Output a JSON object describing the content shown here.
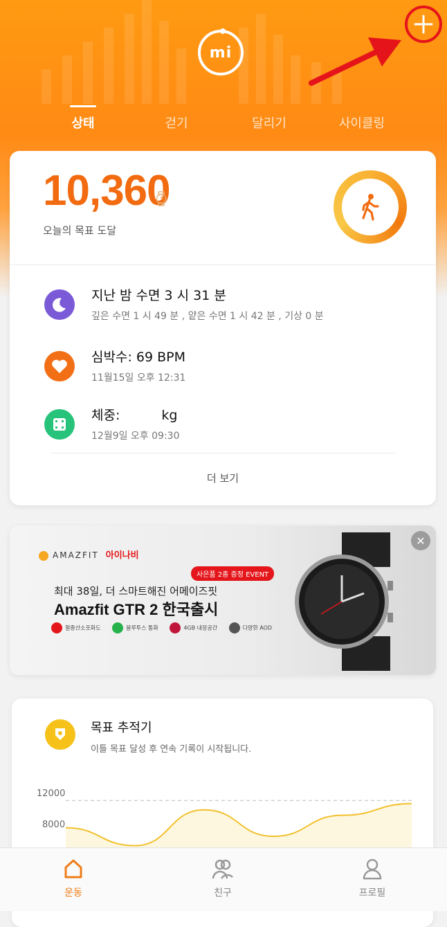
{
  "header": {
    "logo_text": "mi",
    "add_icon": "plus-icon",
    "tabs": [
      {
        "label": "상태",
        "active": true
      },
      {
        "label": "걷기",
        "active": false
      },
      {
        "label": "달리기",
        "active": false
      },
      {
        "label": "사이클링",
        "active": false
      }
    ],
    "accent_color": "#ff8a14"
  },
  "status": {
    "steps": "10,360",
    "goal_text": "오늘의 목표 도달",
    "activity_icon": "walking-person-icon",
    "metrics": [
      {
        "icon": "moon-sleep-icon",
        "title": "지난 밤 수면 3 시 31 분",
        "sub": "깊은 수면 1 시 49 분 , 얕은 수면 1 시 42 분 , 기상 0 분",
        "color": "#7b5ad8"
      },
      {
        "icon": "heart-icon",
        "title": "심박수: 69 BPM",
        "sub": "11월15일 오후 12:31",
        "color": "#f26f16"
      },
      {
        "icon": "scale-icon",
        "title_prefix": "체중:",
        "title_suffix": "kg",
        "sub": "12월9일 오후 09:30",
        "color": "#27c37b"
      }
    ],
    "more_label": "더 보기"
  },
  "ad": {
    "brand": "AMAZFIT",
    "partner": "아이나비",
    "badge": "사은품 2종 증정 EVENT",
    "line1": "최대 38일, 더 스마트해진 어메이즈핏",
    "line2": "Amazfit GTR 2 한국출시",
    "features": [
      "혈중산소포화도",
      "블루투스 통화",
      "4GB 내장공간",
      "다양한 AOD"
    ],
    "close_label": "✕"
  },
  "goal_tracker": {
    "title": "목표 추적기",
    "subtitle": "이틀 목표 달성 후 연속 기록이 시작됩니다.",
    "chart_data": {
      "type": "line",
      "yticks": [
        "12000",
        "8000"
      ],
      "goal_line": 10000,
      "series": [
        {
          "values": [
            7500,
            5200,
            9800,
            6400,
            9100,
            10600
          ]
        }
      ]
    }
  },
  "bottom_nav": [
    {
      "label": "운동",
      "icon": "home-icon",
      "active": true
    },
    {
      "label": "친구",
      "icon": "friends-icon",
      "active": false
    },
    {
      "label": "프로필",
      "icon": "profile-icon",
      "active": false
    }
  ]
}
